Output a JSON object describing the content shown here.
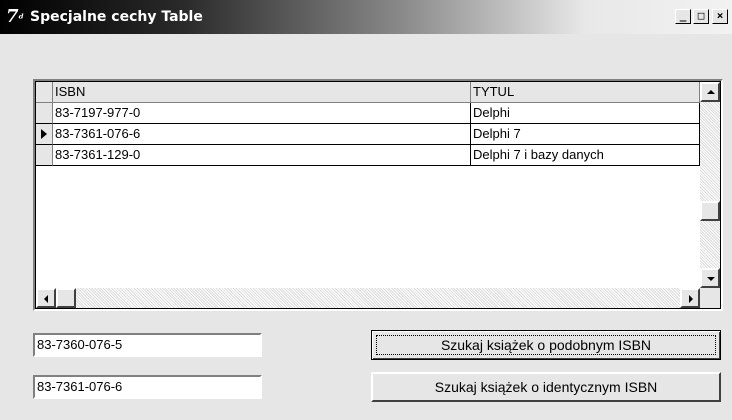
{
  "window": {
    "title": "Specjalne cechy Table",
    "icon": "delphi-7-icon",
    "controls": {
      "minimize": "_",
      "maximize": "□",
      "close": "×"
    }
  },
  "grid": {
    "columns": [
      "ISBN",
      "TYTUL"
    ],
    "rows": [
      {
        "isbn": "83-7197-977-0",
        "title": "Delphi"
      },
      {
        "isbn": "83-7361-076-6",
        "title": "Delphi 7"
      },
      {
        "isbn": "83-7361-129-0",
        "title": "Delphi 7 i bazy danych"
      }
    ],
    "selected_row_index": 1,
    "vertical_scroll_position": 0.68
  },
  "inputs": {
    "similar_isbn": "83-7360-076-5",
    "identical_isbn": "83-7361-076-6"
  },
  "buttons": {
    "find_similar": "Szukaj książek o podobnym ISBN",
    "find_identical": "Szukaj książek o identycznym ISBN"
  }
}
